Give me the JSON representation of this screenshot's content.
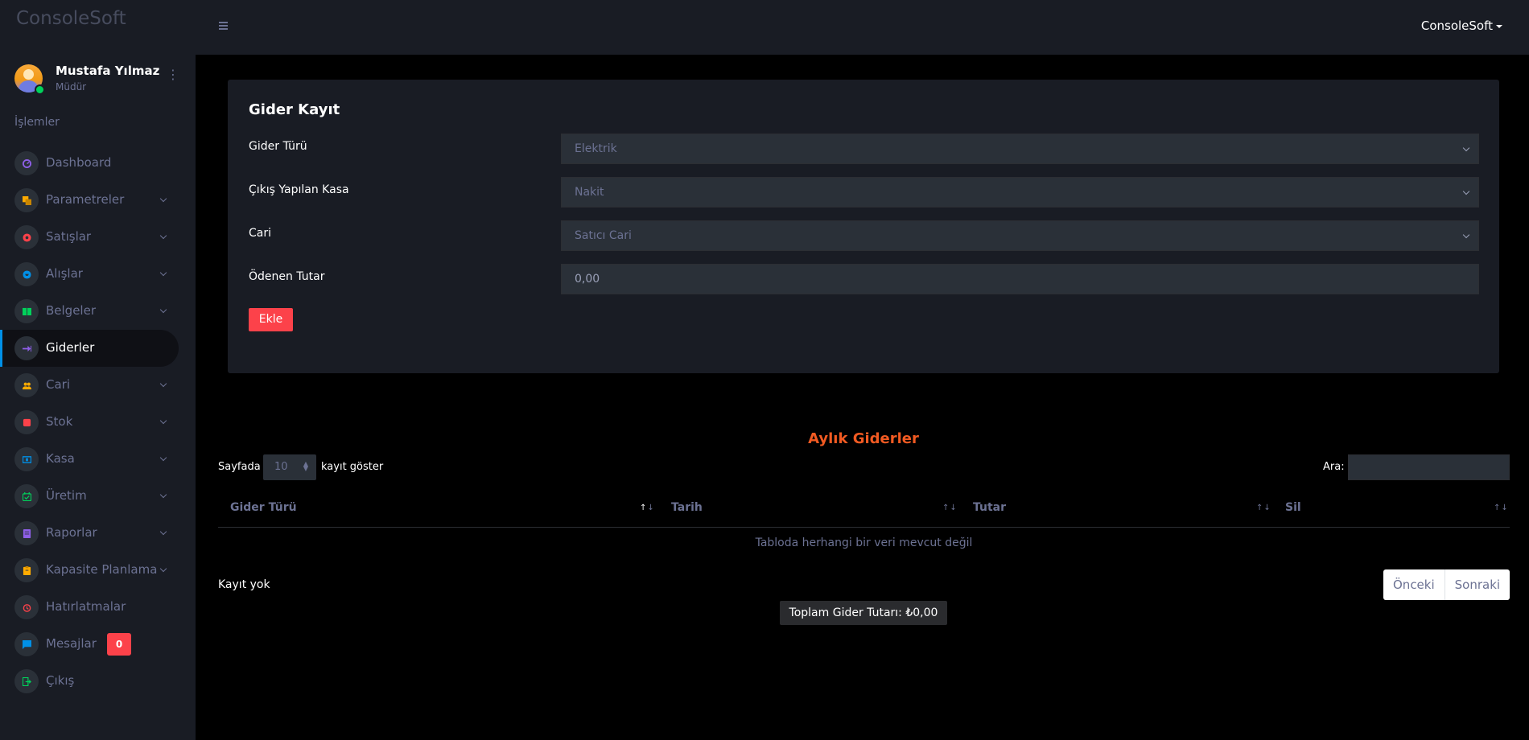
{
  "brand": "ConsoleSoft",
  "profile": {
    "name": "Mustafa Yılmaz",
    "role": "Müdür",
    "menu_icon": "⋮"
  },
  "sidebar": {
    "section": "İşlemler",
    "items": [
      {
        "label": "Dashboard",
        "icon": "speedometer-icon",
        "color": "#8f5fe8",
        "has_chevron": false
      },
      {
        "label": "Parametreler",
        "icon": "layers-icon",
        "color": "#ffab00",
        "has_chevron": true
      },
      {
        "label": "Satışlar",
        "icon": "record-icon",
        "color": "#fc424a",
        "has_chevron": true
      },
      {
        "label": "Alışlar",
        "icon": "cart-icon",
        "color": "#0090e7",
        "has_chevron": true
      },
      {
        "label": "Belgeler",
        "icon": "book-icon",
        "color": "#00d25b",
        "has_chevron": true
      },
      {
        "label": "Giderler",
        "icon": "arrow-right-bold-icon",
        "color": "#8f5fe8",
        "has_chevron": false,
        "active": true
      },
      {
        "label": "Cari",
        "icon": "account-group-icon",
        "color": "#ffab00",
        "has_chevron": true
      },
      {
        "label": "Stok",
        "icon": "cube-icon",
        "color": "#fc424a",
        "has_chevron": true
      },
      {
        "label": "Kasa",
        "icon": "cash-icon",
        "color": "#0090e7",
        "has_chevron": true
      },
      {
        "label": "Üretim",
        "icon": "factory-icon",
        "color": "#00d25b",
        "has_chevron": true
      },
      {
        "label": "Raporlar",
        "icon": "file-chart-icon",
        "color": "#8f5fe8",
        "has_chevron": true
      },
      {
        "label": "Kapasite Planlama",
        "icon": "clipboard-icon",
        "color": "#ffab00",
        "has_chevron": true
      },
      {
        "label": "Hatırlatmalar",
        "icon": "alarm-icon",
        "color": "#fc424a",
        "has_chevron": false
      },
      {
        "label": "Mesajlar",
        "icon": "message-icon",
        "color": "#0090e7",
        "has_chevron": false,
        "badge": "0"
      },
      {
        "label": "Çıkış",
        "icon": "logout-icon",
        "color": "#00d25b",
        "has_chevron": false
      }
    ]
  },
  "topbar": {
    "user": "ConsoleSoft"
  },
  "form": {
    "title": "Gider Kayıt",
    "fields": [
      {
        "label": "Gider Türü",
        "value": "Elektrik",
        "type": "select"
      },
      {
        "label": "Çıkış Yapılan Kasa",
        "value": "Nakit",
        "type": "select"
      },
      {
        "label": "Cari",
        "value": "Satıcı Cari",
        "type": "select"
      },
      {
        "label": "Ödenen Tutar",
        "value": "0,00",
        "type": "input"
      }
    ],
    "submit_label": "Ekle"
  },
  "table": {
    "title": "Aylık Giderler",
    "length_prefix": "Sayfada",
    "length_value": "10",
    "length_suffix": "kayıt göster",
    "search_label": "Ara:",
    "columns": [
      "Gider Türü",
      "Tarih",
      "Tutar",
      "Sil"
    ],
    "empty_text": "Tabloda herhangi bir veri mevcut değil",
    "info": "Kayıt yok",
    "prev_label": "Önceki",
    "next_label": "Sonraki",
    "total_label": "Toplam Gider Tutarı: ₺0,00"
  },
  "colors": {
    "accent_red": "#fc424a",
    "title_orange": "#f15a22",
    "sidebar_bg": "#191c24"
  }
}
